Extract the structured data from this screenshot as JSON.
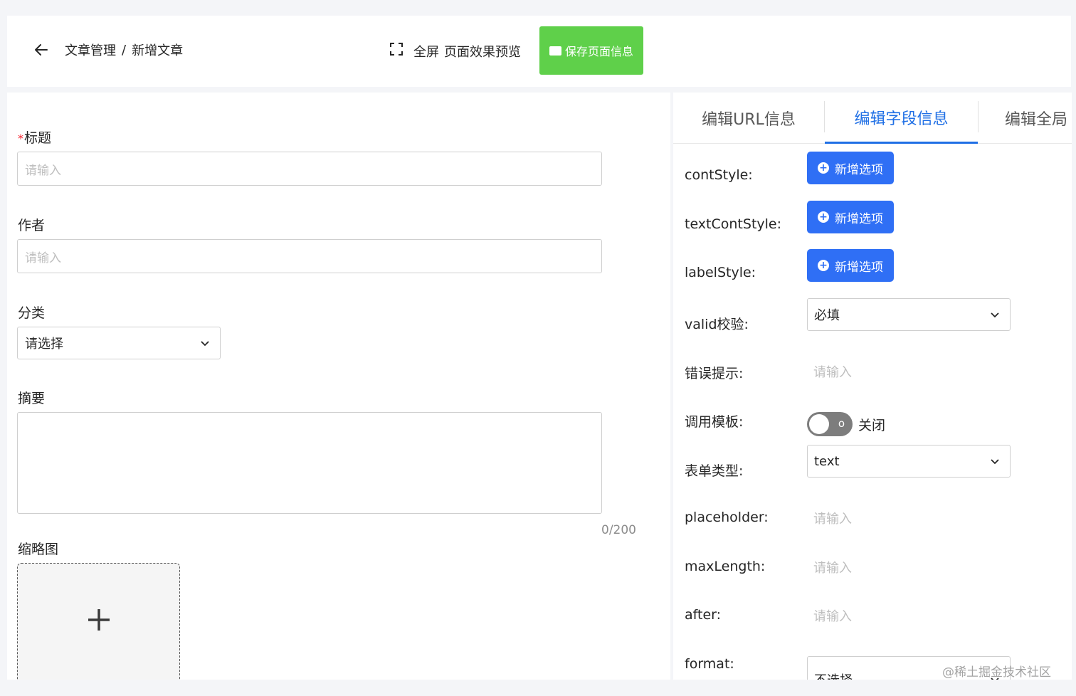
{
  "header": {
    "breadcrumb_parent": "文章管理",
    "breadcrumb_sep": "/",
    "breadcrumb_current": "新增文章",
    "fullscreen_label": "全屏",
    "preview_label": "页面效果预览",
    "save_label": "保存页面信息"
  },
  "form": {
    "title_required_mark": "*",
    "title_label": "标题",
    "title_placeholder": "请输入",
    "author_label": "作者",
    "author_placeholder": "请输入",
    "category_label": "分类",
    "category_value": "请选择",
    "summary_label": "摘要",
    "summary_counter": "0/200",
    "thumbnail_label": "缩略图",
    "thumbnail_add": "+"
  },
  "tabs": [
    {
      "label": "编辑URL信息",
      "active": false
    },
    {
      "label": "编辑字段信息",
      "active": true
    },
    {
      "label": "编辑全局",
      "active": false
    }
  ],
  "fields": {
    "contStyle_label": "contStyle:",
    "textContStyle_label": "textContStyle:",
    "labelStyle_label": "labelStyle:",
    "add_option_label": "新增选项",
    "valid_label": "valid校验:",
    "valid_value": "必填",
    "error_label": "错误提示:",
    "error_placeholder": "请输入",
    "template_label": "调用模板:",
    "template_switch_state": "o",
    "template_switch_text": "关闭",
    "form_type_label": "表单类型:",
    "form_type_value": "text",
    "placeholder_label": "placeholder:",
    "placeholder_placeholder": "请输入",
    "maxLength_label": "maxLength:",
    "maxLength_placeholder": "请输入",
    "after_label": "after:",
    "after_placeholder": "请输入",
    "format_label": "format:",
    "format_value": "不选择"
  },
  "watermark": "@稀土掘金技术社区",
  "colors": {
    "accent": "#2f6ff5",
    "save_green": "#5fd04a",
    "tab_active": "#1f6fe5"
  }
}
